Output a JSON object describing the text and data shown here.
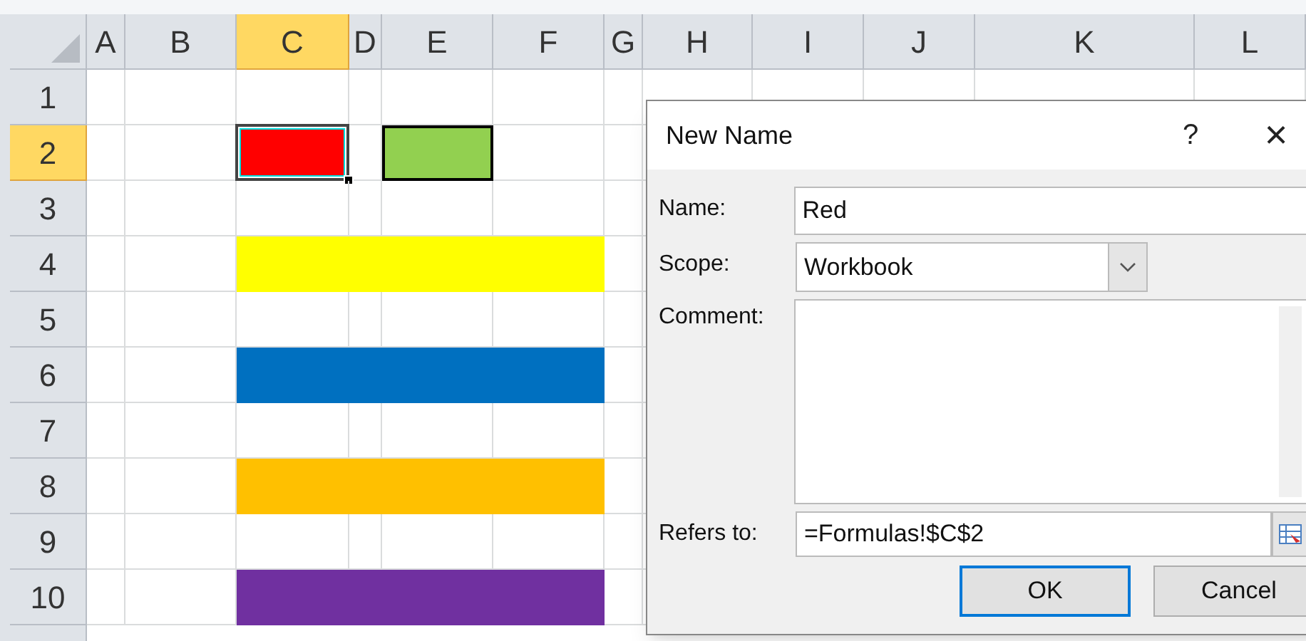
{
  "sheet": {
    "columns": [
      {
        "label": "A",
        "selected": false
      },
      {
        "label": "B",
        "selected": false
      },
      {
        "label": "C",
        "selected": true
      },
      {
        "label": "D",
        "selected": false
      },
      {
        "label": "E",
        "selected": false
      },
      {
        "label": "F",
        "selected": false
      },
      {
        "label": "G",
        "selected": false
      },
      {
        "label": "H",
        "selected": false
      },
      {
        "label": "I",
        "selected": false
      },
      {
        "label": "J",
        "selected": false
      },
      {
        "label": "K",
        "selected": false
      },
      {
        "label": "L",
        "selected": false
      }
    ],
    "rows": [
      {
        "label": "1",
        "selected": false,
        "blocks": []
      },
      {
        "label": "2",
        "selected": true,
        "blocks": [
          {
            "kind": "selected-cell",
            "color": "#ff0000"
          },
          {
            "kind": "bordered-cell",
            "color": "#92d050"
          }
        ]
      },
      {
        "label": "3",
        "selected": false,
        "blocks": []
      },
      {
        "label": "4",
        "selected": false,
        "blocks": [
          {
            "kind": "band",
            "color": "#ffff00"
          }
        ]
      },
      {
        "label": "5",
        "selected": false,
        "blocks": []
      },
      {
        "label": "6",
        "selected": false,
        "blocks": [
          {
            "kind": "band",
            "color": "#0070c0"
          }
        ]
      },
      {
        "label": "7",
        "selected": false,
        "blocks": []
      },
      {
        "label": "8",
        "selected": false,
        "blocks": [
          {
            "kind": "band",
            "color": "#ffc000"
          }
        ]
      },
      {
        "label": "9",
        "selected": false,
        "blocks": []
      },
      {
        "label": "10",
        "selected": false,
        "blocks": [
          {
            "kind": "band",
            "color": "#7030a0"
          }
        ]
      }
    ]
  },
  "dialog": {
    "title": "New Name",
    "help": "?",
    "close": "×",
    "name": {
      "label": "Name:",
      "value": "Red"
    },
    "scope": {
      "label": "Scope:",
      "value": "Workbook"
    },
    "comment": {
      "label": "Comment:"
    },
    "refers_to": {
      "label": "Refers to:",
      "value": "=Formulas!$C$2"
    },
    "buttons": [
      "OK",
      "Cancel"
    ]
  }
}
